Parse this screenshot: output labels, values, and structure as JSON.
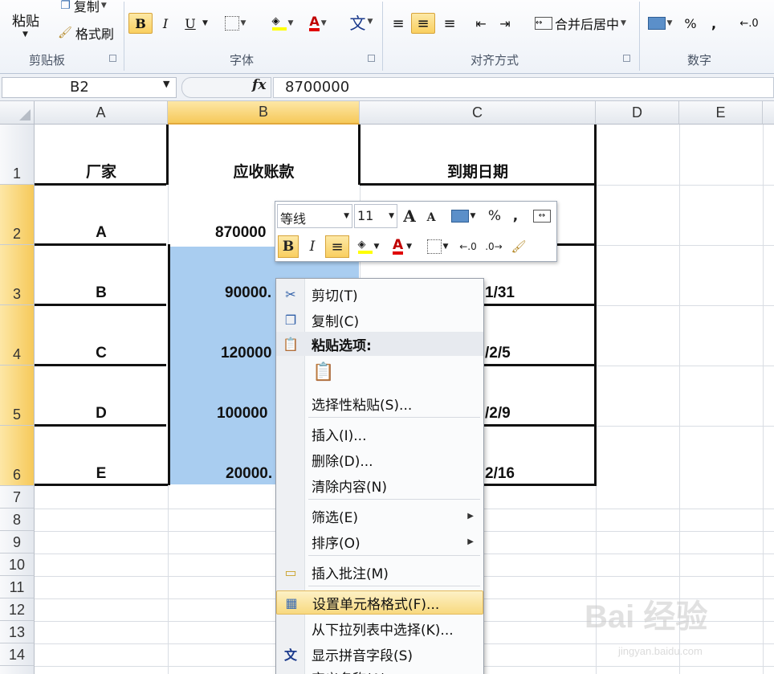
{
  "ribbon": {
    "paste_label": "粘贴",
    "copy_label": "复制",
    "format_painter_label": "格式刷",
    "clipboard_group": "剪贴板",
    "font_group": "字体",
    "align_group": "对齐方式",
    "number_group": "数字",
    "bold": "B",
    "italic": "I",
    "underline": "U",
    "font_color_glyph": "A",
    "phonetic_glyph": "文",
    "merge_label": "合并后居中",
    "percent": "%",
    "comma": ","
  },
  "formula_bar": {
    "name_box": "B2",
    "fx": "fx",
    "value": "8700000"
  },
  "columns": [
    "A",
    "B",
    "C",
    "D",
    "E"
  ],
  "rows": [
    "1",
    "2",
    "3",
    "4",
    "5",
    "6",
    "7",
    "8",
    "9",
    "10",
    "11",
    "12",
    "13",
    "14"
  ],
  "cells": {
    "a1": "厂家",
    "b1": "应收账款",
    "c1": "到期日期",
    "a2": "A",
    "b2": "870000",
    "a3": "B",
    "b3": "90000.",
    "c3": "1/31",
    "a4": "C",
    "b4": "120000",
    "c4": "/2/5",
    "a5": "D",
    "b5": "100000",
    "c5": "/2/9",
    "a6": "E",
    "b6": "20000.",
    "c6": "2/16"
  },
  "mini_toolbar": {
    "font_name": "等线",
    "font_size": "11",
    "grow_font": "A",
    "shrink_font": "A",
    "percent": "%",
    "comma": ",",
    "bold": "B",
    "italic": "I",
    "font_color_glyph": "A"
  },
  "context_menu": {
    "cut": "剪切(T)",
    "copy": "复制(C)",
    "paste_options": "粘贴选项:",
    "paste_special": "选择性粘贴(S)...",
    "insert": "插入(I)...",
    "delete": "删除(D)...",
    "clear": "清除内容(N)",
    "filter": "筛选(E)",
    "sort": "排序(O)",
    "insert_comment": "插入批注(M)",
    "format_cells": "设置单元格格式(F)...",
    "pick_list": "从下拉列表中选择(K)...",
    "phonetic": "显示拼音字段(S)",
    "cutoff_item": "定义名称(A)..."
  },
  "watermark": {
    "brand": "Bai 经验",
    "url": "jingyan.baidu.com"
  },
  "colors": {
    "selection": "#a9cdf0",
    "highlight": "#f8d97f",
    "header_selected": "#f6c95a"
  }
}
